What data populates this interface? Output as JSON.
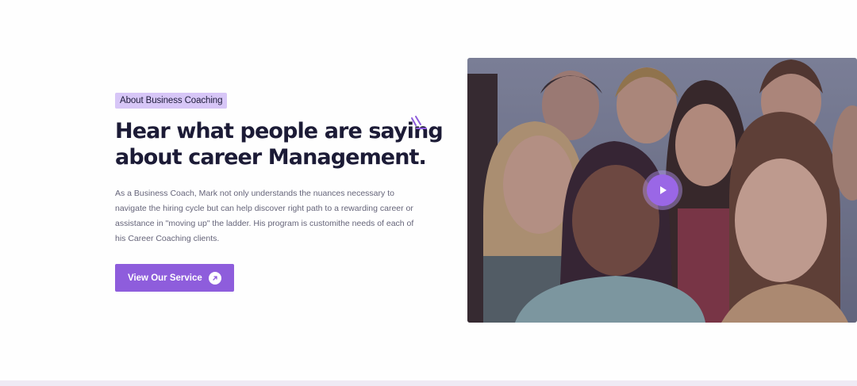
{
  "section": {
    "badge": "About Business Coaching",
    "headline_line1": "Hear what people are saying",
    "headline_line2": "about career Management.",
    "description": "As a Business Coach, Mark not only understands the nuances necessary to navigate the hiring cycle but can help discover right path to a rewarding career or assistance in \"moving up\" the ladder. His program is customithe needs of each of his Career Coaching clients.",
    "cta_label": "View Our Service",
    "cta_icon": "arrow-up-right-icon"
  },
  "media": {
    "play_icon": "play-icon"
  },
  "colors": {
    "accent": "#8e5ddc",
    "badge_bg": "#d7c6f7",
    "heading": "#1c1b36",
    "body": "#66657a"
  }
}
